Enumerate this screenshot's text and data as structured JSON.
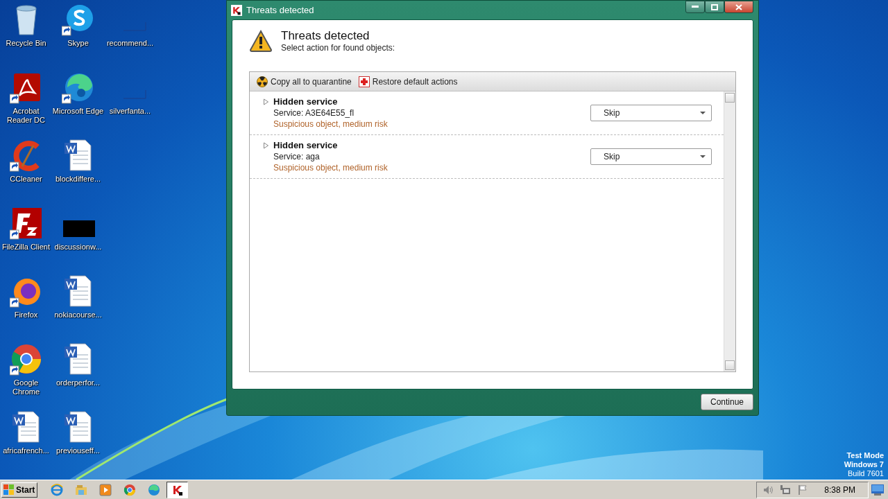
{
  "desktop": {
    "columns": [
      [
        {
          "label": "Recycle Bin",
          "kind": "recycle",
          "shortcut": false
        },
        {
          "label": "Acrobat Reader DC",
          "kind": "pdf",
          "shortcut": true
        },
        {
          "label": "CCleaner",
          "kind": "ccleaner",
          "shortcut": true
        },
        {
          "label": "FileZilla Client",
          "kind": "filezilla",
          "shortcut": true
        },
        {
          "label": "Firefox",
          "kind": "firefox",
          "shortcut": true
        },
        {
          "label": "Google Chrome",
          "kind": "chrome",
          "shortcut": true
        },
        {
          "label": "africafrench...",
          "kind": "word",
          "shortcut": false
        }
      ],
      [
        {
          "label": "Skype",
          "kind": "skype",
          "shortcut": true
        },
        {
          "label": "Microsoft Edge",
          "kind": "edge",
          "shortcut": true
        },
        {
          "label": "blockdiffere...",
          "kind": "word",
          "shortcut": false
        },
        {
          "label": "discussionw...",
          "kind": "black",
          "shortcut": false
        },
        {
          "label": "nokiacourse...",
          "kind": "word",
          "shortcut": false
        },
        {
          "label": "orderperfor...",
          "kind": "word",
          "shortcut": false
        },
        {
          "label": "previouseff...",
          "kind": "word",
          "shortcut": false
        }
      ],
      [
        {
          "label": "recommend...",
          "kind": "blank",
          "shortcut": false
        },
        {
          "label": "silverfanta...",
          "kind": "blank",
          "shortcut": false
        }
      ]
    ],
    "os_notice": [
      "Test Mode",
      "Windows 7",
      "Build 7601"
    ]
  },
  "window": {
    "title": "Threats detected",
    "heading": "Threats detected",
    "subheading": "Select action for found objects:",
    "toolbar": [
      {
        "label": "Copy all to quarantine",
        "kind": "quarantine"
      },
      {
        "label": "Restore default actions",
        "kind": "restore"
      }
    ],
    "threats": [
      {
        "name": "Hidden service",
        "detail": "Service: A3E64E55_fl",
        "risk": "Suspicious object, medium risk",
        "action": "Skip",
        "expanded": false
      },
      {
        "name": "Hidden service",
        "detail": "Service: aga",
        "risk": "Suspicious object, medium risk",
        "action": "Skip",
        "expanded": false
      }
    ],
    "continue_button": "Continue"
  },
  "taskbar": {
    "start": "Start",
    "apps": [
      {
        "kind": "ie",
        "selected": false
      },
      {
        "kind": "explorer",
        "selected": false
      },
      {
        "kind": "media",
        "selected": false
      },
      {
        "kind": "chrome",
        "selected": false
      },
      {
        "kind": "edge",
        "selected": false
      },
      {
        "kind": "kaspersky",
        "selected": true
      }
    ],
    "clock": "8:38 PM"
  }
}
